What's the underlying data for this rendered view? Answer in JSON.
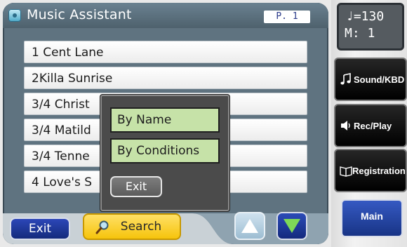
{
  "app": {
    "title": "Music Assistant",
    "page": "P.  1"
  },
  "songs": [
    "1 Cent Lane",
    "2Killa Sunrise",
    "3/4 Christ",
    "3/4 Matild",
    "3/4 Tenne",
    "4 Love's S"
  ],
  "popup": {
    "options": [
      "By Name",
      "By Conditions"
    ],
    "exit_label": "Exit"
  },
  "footer": {
    "exit_label": "Exit",
    "search_label": "Search"
  },
  "tempo": {
    "note": "♩",
    "bpm": "=130",
    "measure": "M:  1"
  },
  "side_buttons": {
    "sound": "Sound/KBD",
    "rec": "Rec/Play",
    "registration": "Registration",
    "main": "Main"
  },
  "icons": {
    "app": "music-assistant-icon",
    "search": "magnifier-icon",
    "up": "triangle-up-icon",
    "down": "triangle-down-icon"
  },
  "colors": {
    "panel": "#5f7380",
    "search": "#f6c40c",
    "option_bg": "#c6e2a8",
    "blue_button": "#1e3a9a"
  }
}
